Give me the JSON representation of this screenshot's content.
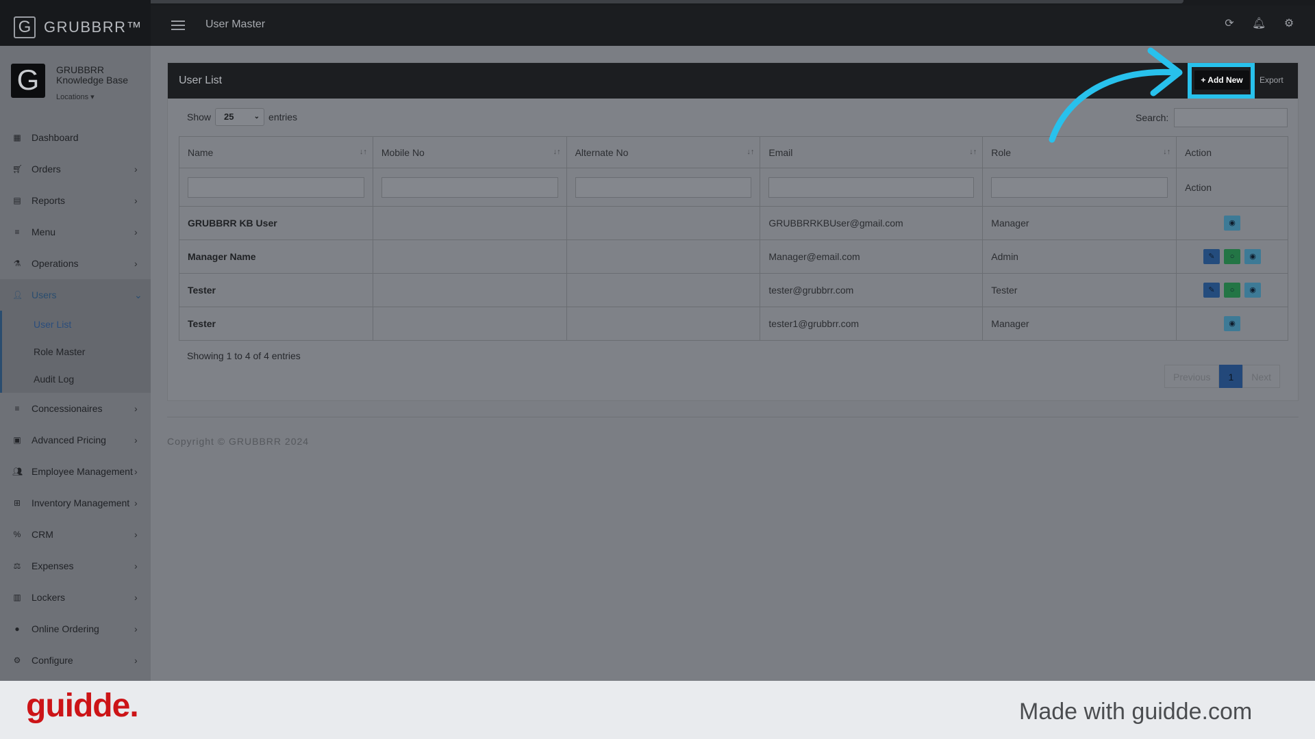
{
  "app": {
    "brand": "GRUBBRR™",
    "org_name_line1": "GRUBBRR",
    "org_name_line2": "Knowledge Base",
    "locations_label": "Locations ▾"
  },
  "header": {
    "title": "User Master"
  },
  "sidebar": {
    "items": [
      {
        "label": "Dashboard",
        "icon": "dashboard-icon",
        "chevron": false
      },
      {
        "label": "Orders",
        "icon": "cart-icon",
        "chevron": true
      },
      {
        "label": "Reports",
        "icon": "report-icon",
        "chevron": true
      },
      {
        "label": "Menu",
        "icon": "list-icon",
        "chevron": true
      },
      {
        "label": "Operations",
        "icon": "flask-icon",
        "chevron": true
      },
      {
        "label": "Users",
        "icon": "user-add-icon",
        "chevron": true,
        "active": true
      },
      {
        "label": "Concessionaires",
        "icon": "list-icon",
        "chevron": true
      },
      {
        "label": "Advanced Pricing",
        "icon": "money-icon",
        "chevron": true
      },
      {
        "label": "Employee Management",
        "icon": "users-icon",
        "chevron": true
      },
      {
        "label": "Inventory Management",
        "icon": "sitemap-icon",
        "chevron": true
      },
      {
        "label": "CRM",
        "icon": "percent-icon",
        "chevron": true
      },
      {
        "label": "Expenses",
        "icon": "balance-icon",
        "chevron": true
      },
      {
        "label": "Lockers",
        "icon": "locker-icon",
        "chevron": true
      },
      {
        "label": "Online Ordering",
        "icon": "globe-icon",
        "chevron": true
      },
      {
        "label": "Configure",
        "icon": "gear-icon",
        "chevron": true
      }
    ],
    "users_sub": [
      "User List",
      "Role Master",
      "Audit Log"
    ]
  },
  "panel": {
    "title": "User List",
    "add_new": "Add New",
    "export": "Export",
    "show_label": "Show",
    "entries_label": "entries",
    "page_size": "25",
    "search_label": "Search:"
  },
  "table": {
    "columns": [
      "Name",
      "Mobile No",
      "Alternate No",
      "Email",
      "Role",
      "Action"
    ],
    "filter_action_label": "Action",
    "rows": [
      {
        "name": "GRUBBRR KB User",
        "mobile": "",
        "alternate": "",
        "email": "GRUBBRRKBUser@gmail.com",
        "role": "Manager"
      },
      {
        "name": "Manager Name",
        "mobile": "",
        "alternate": "",
        "email": "Manager@email.com",
        "role": "Admin"
      },
      {
        "name": "Tester",
        "mobile": "",
        "alternate": "",
        "email": "tester@grubbrr.com",
        "role": "Tester"
      },
      {
        "name": "Tester",
        "mobile": "",
        "alternate": "",
        "email": "tester1@grubbrr.com",
        "role": "Manager"
      }
    ]
  },
  "pagination": {
    "info": "Showing 1 to 4 of 4 entries",
    "previous": "Previous",
    "current": "1",
    "next": "Next"
  },
  "copyright": "Copyright © GRUBBRR 2024",
  "footer": {
    "logo": "guidde.",
    "made_with": "Made with guidde.com"
  },
  "colors": {
    "highlight": "#28c1ec",
    "brand_red": "#cc1417"
  }
}
